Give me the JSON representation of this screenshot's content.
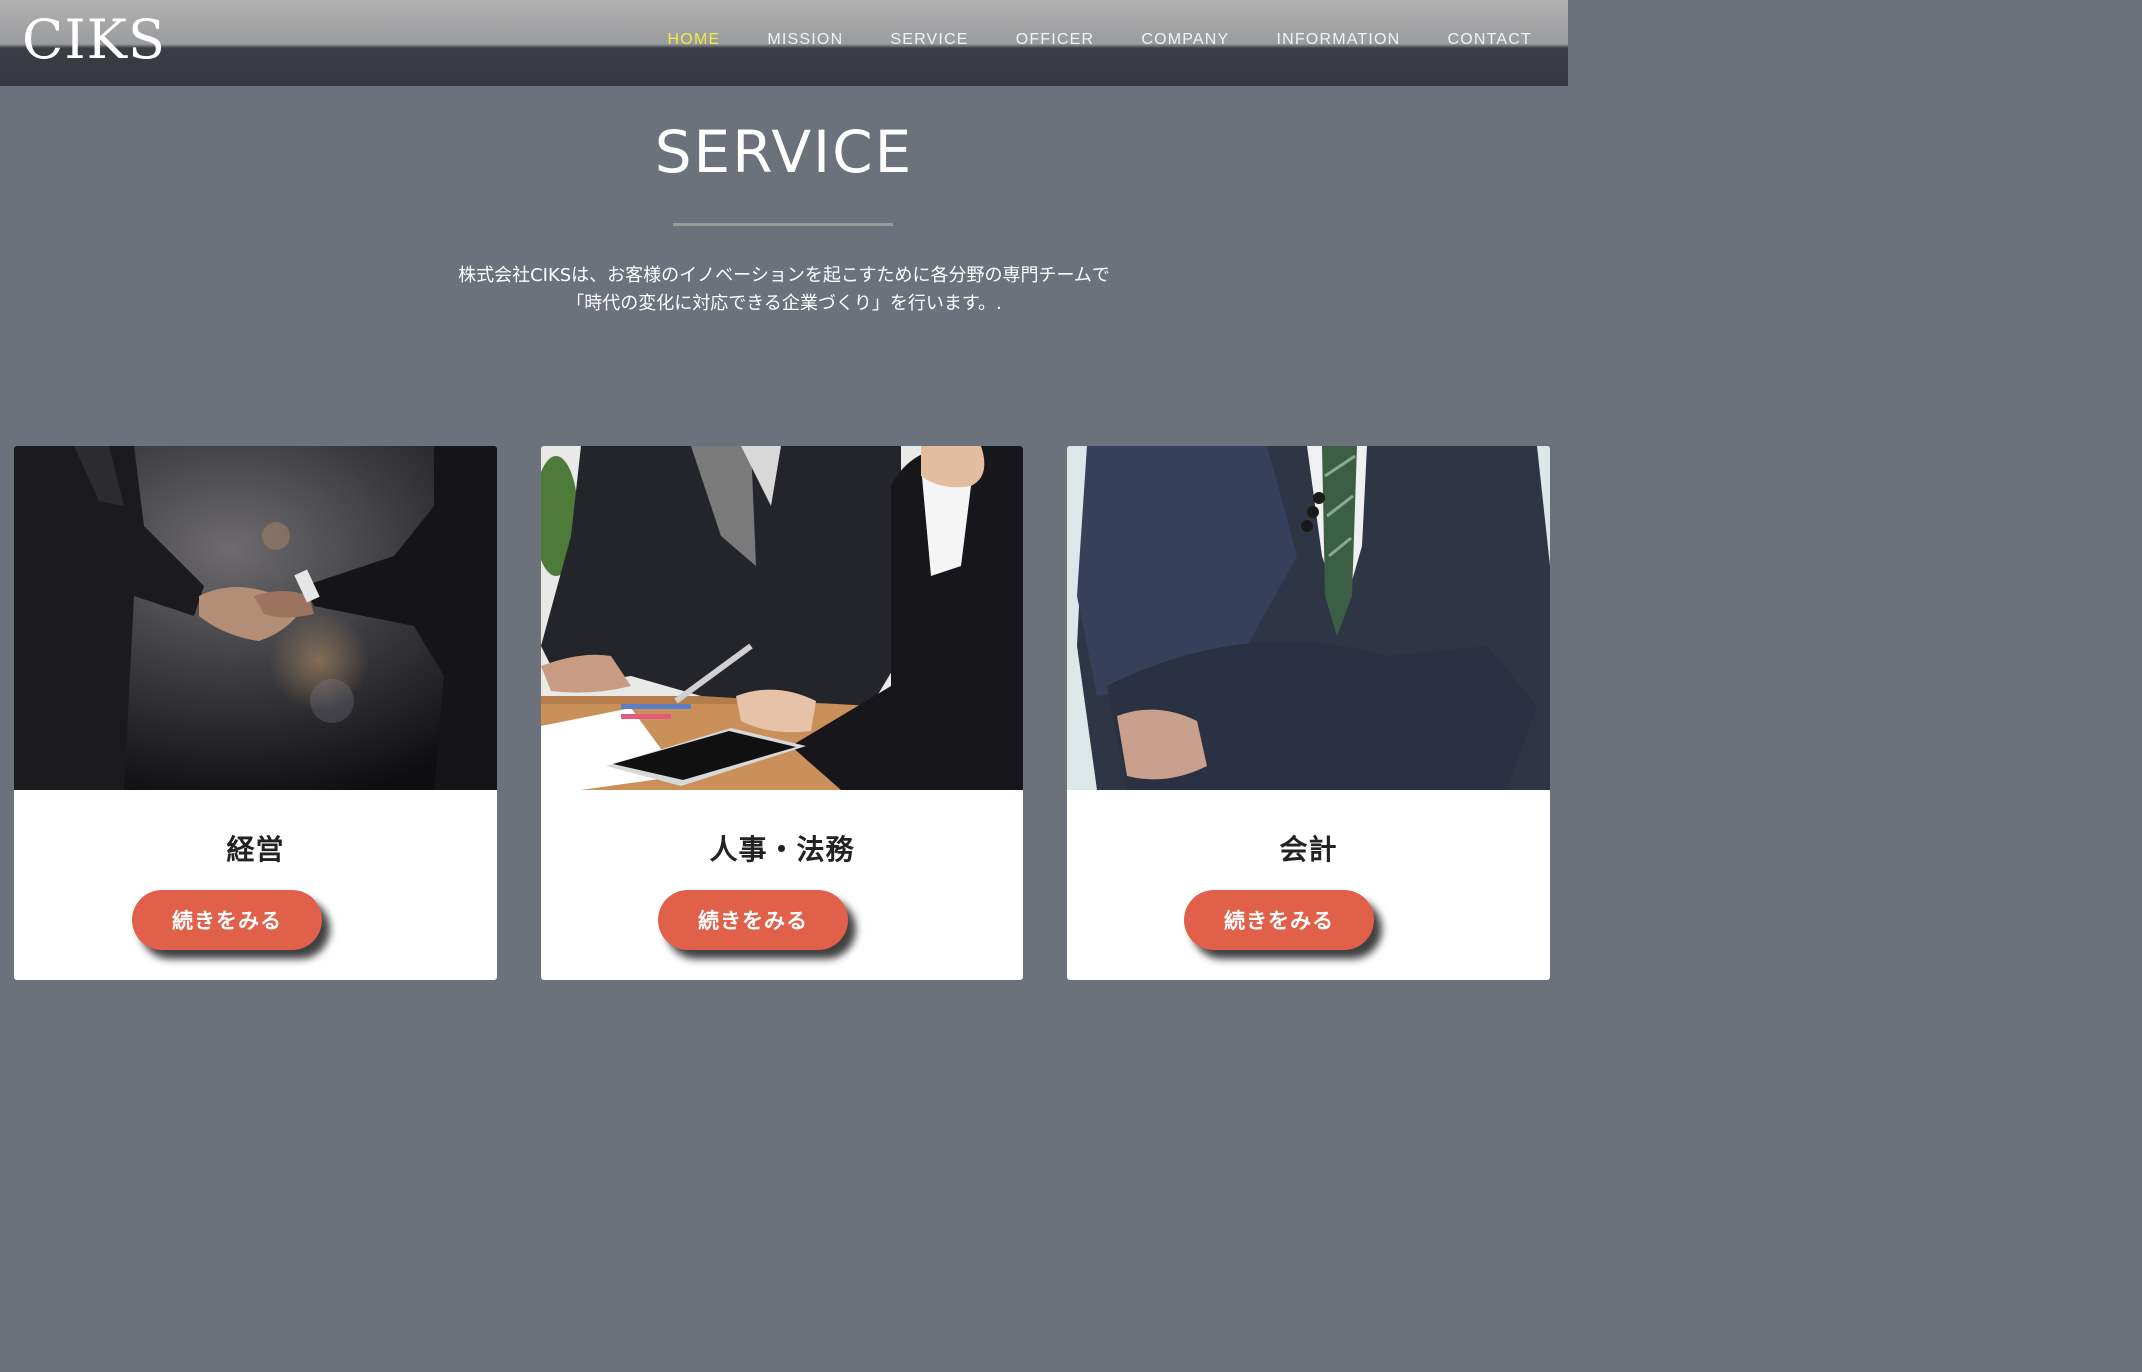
{
  "header": {
    "logo": "CIKS",
    "nav": [
      {
        "label": "HOME",
        "active": true
      },
      {
        "label": "MISSION",
        "active": false
      },
      {
        "label": "SERVICE",
        "active": false
      },
      {
        "label": "OFFICER",
        "active": false
      },
      {
        "label": "COMPANY",
        "active": false
      },
      {
        "label": "INFORMATION",
        "active": false
      },
      {
        "label": "CONTACT",
        "active": false
      }
    ]
  },
  "service": {
    "title": "SERVICE",
    "intro_line1": "株式会社CIKSは、お客様のイノベーションを起こすために各分野の専門チームで",
    "intro_line2": "「時代の変化に対応できる企業づくり」を行います。.",
    "cards": [
      {
        "title": "経営",
        "button": "続きをみる",
        "image": "handshake-photo"
      },
      {
        "title": "人事・法務",
        "button": "続きをみる",
        "image": "meeting-photo"
      },
      {
        "title": "会計",
        "button": "続きをみる",
        "image": "businessman-photo"
      }
    ]
  },
  "colors": {
    "background": "#6b727b",
    "nav_active": "#f4e94a",
    "button": "#e0604a"
  }
}
